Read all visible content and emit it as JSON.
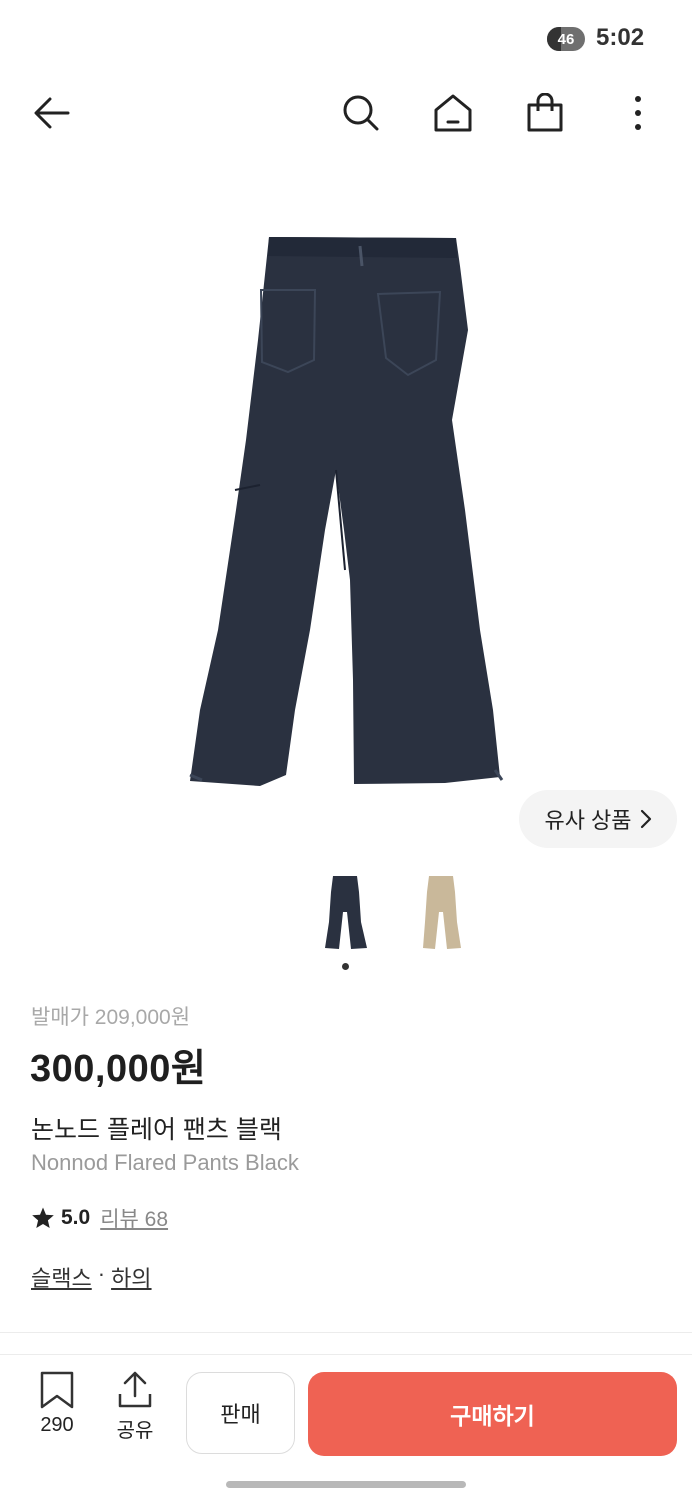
{
  "status_bar": {
    "battery": "46",
    "time": "5:02"
  },
  "nav": {
    "back_icon": "arrow-left-icon",
    "search_icon": "search-icon",
    "home_icon": "home-icon",
    "bag_icon": "shopping-bag-icon",
    "more_icon": "more-vertical-icon"
  },
  "product": {
    "similar_label": "유사 상품",
    "release_price": "발매가 209,000원",
    "price": "300,000원",
    "name_kr": "논노드 플레어 팬츠 블랙",
    "name_en": "Nonnod Flared Pants Black",
    "rating": "5.0",
    "review_label": "리뷰 68",
    "categories": [
      "슬랙스",
      "하의"
    ],
    "category_separator": "·",
    "image_count": 2,
    "active_image_index": 0
  },
  "bottom": {
    "bookmark_count": "290",
    "share_label": "공유",
    "sell_label": "판매",
    "buy_label": "구매하기"
  },
  "colors": {
    "accent": "#ef6253",
    "pants_primary": "#2a3140",
    "pants_beige": "#c9b89a"
  }
}
